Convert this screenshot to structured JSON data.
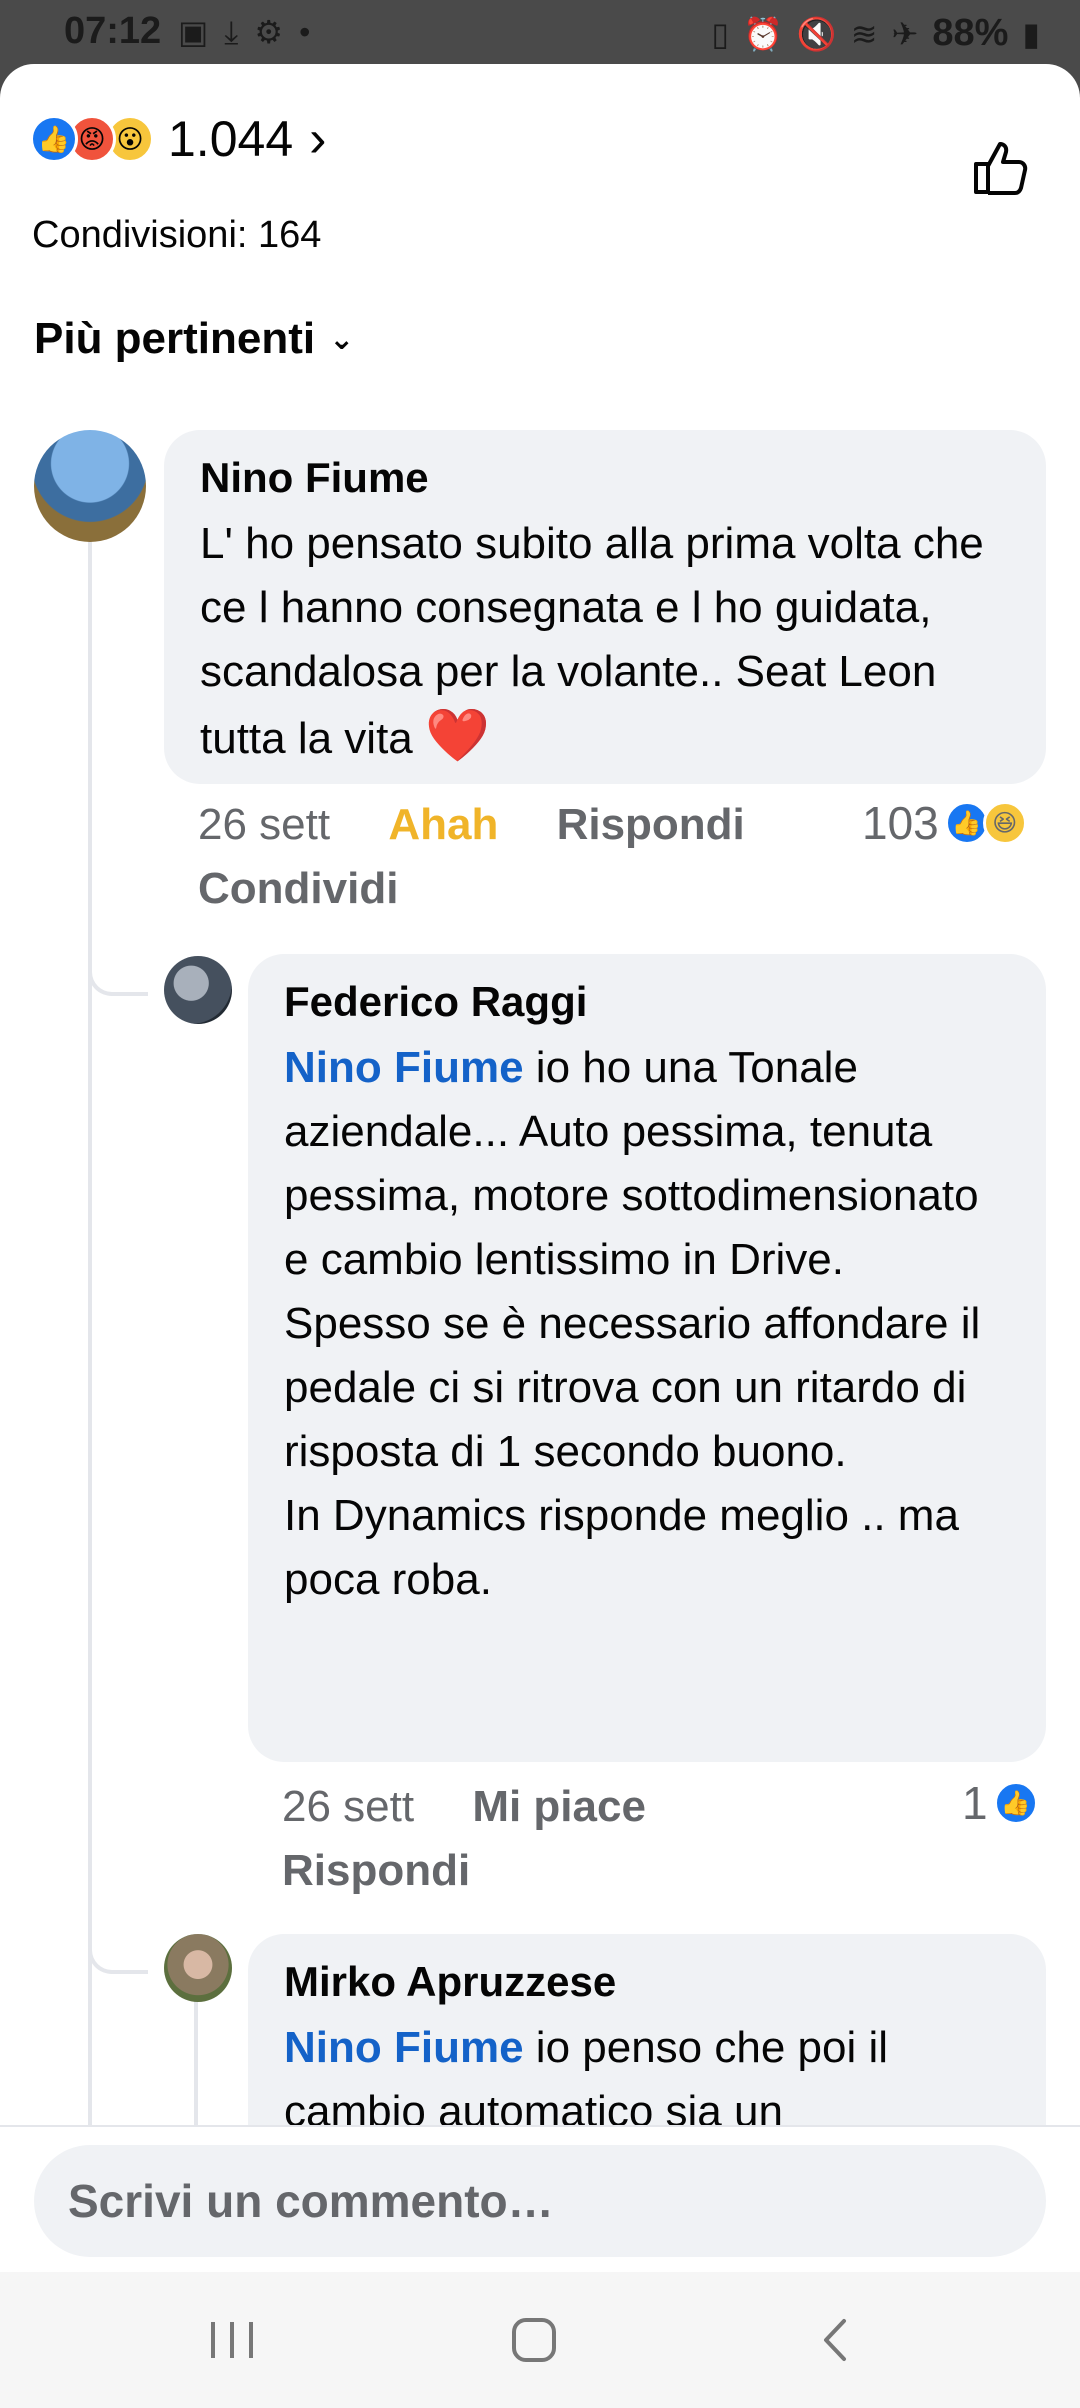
{
  "status_bar": {
    "time": "07:12",
    "battery": "88%"
  },
  "post": {
    "reaction_count": "1.044",
    "shares": "Condivisioni: 164",
    "sort_label": "Più pertinenti"
  },
  "comments": [
    {
      "author": "Nino Fiume",
      "text": "L' ho pensato subito alla prima volta che ce l hanno consegnata e l ho guidata, scandalosa per la volante.. Seat Leon tutta la vita",
      "emoji": "❤️",
      "time": "26 sett",
      "reaction_label": "Ahah",
      "reply_label": "Rispondi",
      "share_label": "Condividi",
      "reaction_total": "103"
    },
    {
      "author": "Federico Raggi",
      "mention": "Nino Fiume",
      "text": " io ho una Tonale aziendale... Auto pessima, tenuta pessima, motore sottodimensionato e cambio lentissimo in Drive.\nSpesso se è necessario affondare il pedale ci si ritrova con un ritardo di risposta di 1 secondo buono.\nIn Dynamics risponde meglio .. ma poca roba.",
      "time": "26 sett",
      "like_label": "Mi piace",
      "reply_label": "Rispondi",
      "reaction_total": "1"
    },
    {
      "author": "Mirko Apruzzese",
      "mention": "Nino Fiume",
      "text": " io penso che poi il cambio automatico sia un"
    }
  ],
  "composer": {
    "placeholder": "Scrivi un commento…"
  },
  "colors": {
    "facebook_blue": "#1877f2",
    "mention": "#1462c8",
    "haha": "#f0b429",
    "bubble": "#f0f2f5"
  }
}
